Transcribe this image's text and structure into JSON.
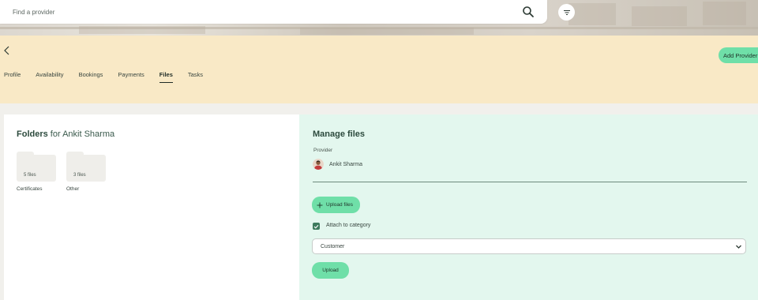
{
  "search": {
    "placeholder": "Find a provider"
  },
  "header": {
    "add_provider_label": "Add Provider",
    "tabs": [
      {
        "label": "Profile"
      },
      {
        "label": "Availability"
      },
      {
        "label": "Bookings"
      },
      {
        "label": "Payments"
      },
      {
        "label": "Files",
        "active": true
      },
      {
        "label": "Tasks"
      }
    ]
  },
  "folders": {
    "title_bold": "Folders",
    "title_rest": "for Ankit Sharma",
    "items": [
      {
        "count": "5 files",
        "name": "Certificates"
      },
      {
        "count": "3 files",
        "name": "Other"
      }
    ]
  },
  "manage": {
    "title": "Manage files",
    "provider_label": "Provider",
    "provider_name": "Ankit Sharma",
    "upload_files_label": "Upload files",
    "attach_label": "Attach to category",
    "attach_checked": true,
    "category_value": "Customer",
    "upload_label": "Upload"
  },
  "colors": {
    "accent_green": "#6fdfa8",
    "header_bg": "#f9e9c6",
    "manage_bg": "#e3f7ee",
    "checkbox_green": "#3d7b5e"
  },
  "icons": [
    "search-icon",
    "filter-icon",
    "back-chevron-icon",
    "plus-icon",
    "check-icon",
    "chevron-down-icon"
  ]
}
